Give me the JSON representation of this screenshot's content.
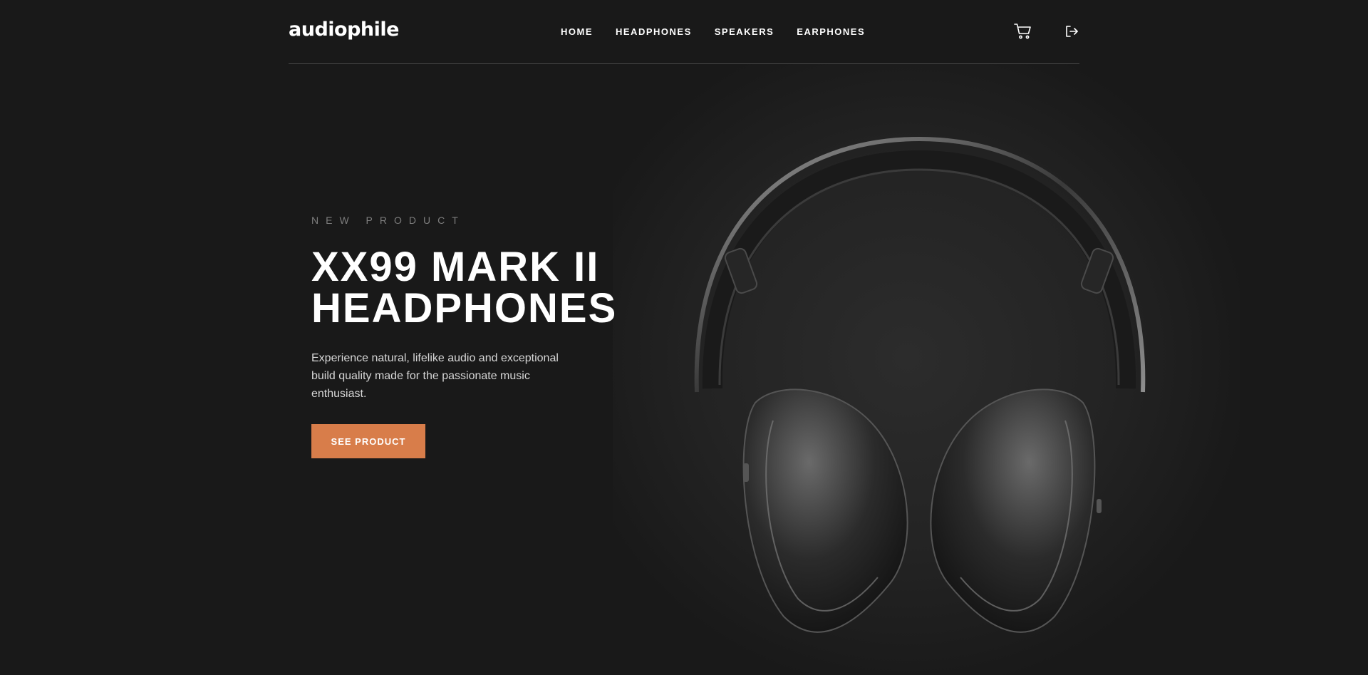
{
  "header": {
    "logo": "audiophile",
    "nav": [
      "HOME",
      "HEADPHONES",
      "SPEAKERS",
      "EARPHONES"
    ],
    "icons": [
      "cart-icon",
      "logout-icon"
    ]
  },
  "hero": {
    "overline": "NEW PRODUCT",
    "title_line1": "XX99 MARK II",
    "title_line2": "HEADPHONES",
    "description": "Experience natural, lifelike audio and exceptional build quality made for the passionate music enthusiast.",
    "cta_label": "SEE PRODUCT"
  },
  "colors": {
    "background": "#191919",
    "accent": "#d87d4a",
    "overline": "#7d7d7d"
  }
}
